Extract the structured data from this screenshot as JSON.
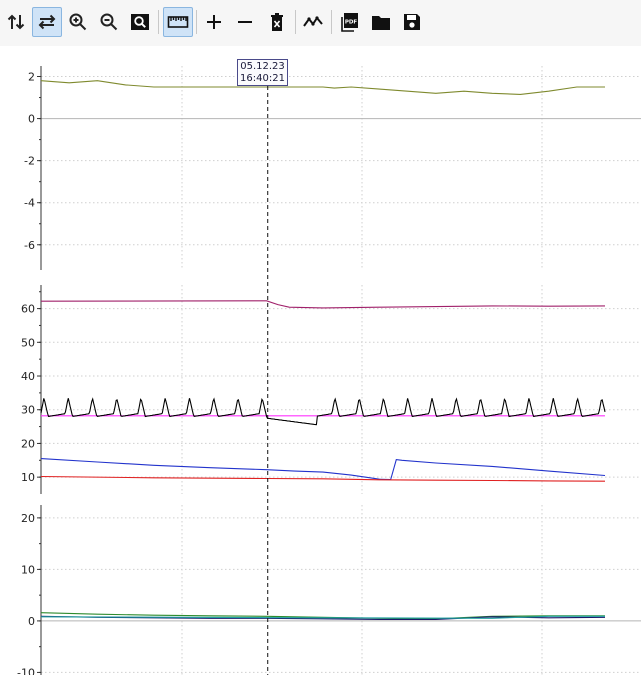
{
  "toolbar": {
    "buttons": [
      {
        "name": "vertical-arrows-icon",
        "active": false
      },
      {
        "name": "horizontal-arrows-icon",
        "active": true
      },
      {
        "name": "zoom-in-icon",
        "active": false
      },
      {
        "name": "zoom-out-icon",
        "active": false
      },
      {
        "name": "zoom-fit-icon",
        "active": false
      },
      {
        "name": "ruler-icon",
        "active": true
      },
      {
        "name": "plus-icon",
        "active": false
      },
      {
        "name": "minus-icon",
        "active": false
      },
      {
        "name": "delete-icon",
        "active": false
      },
      {
        "name": "line-graph-icon",
        "active": false
      },
      {
        "name": "pdf-icon",
        "active": false
      },
      {
        "name": "folder-icon",
        "active": false
      },
      {
        "name": "save-icon",
        "active": false
      }
    ],
    "pdf_icon_text": "PDF"
  },
  "cursor": {
    "date": "05.12.23",
    "time": "16:40:21"
  },
  "chart_data": [
    {
      "type": "line",
      "ylim": [
        -7.2,
        2.5
      ],
      "yticks": [
        "2",
        "0",
        "-2",
        "-4",
        "-6"
      ],
      "ytick_values": [
        2,
        0,
        -2,
        -4,
        -6
      ],
      "grid": true,
      "x_range": [
        0,
        100
      ],
      "series": [
        {
          "color": "#7f8a2e",
          "x": [
            0,
            5,
            10,
            15,
            20,
            30,
            40,
            50,
            52,
            55,
            60,
            65,
            70,
            75,
            80,
            85,
            90,
            95,
            100
          ],
          "y": [
            1.8,
            1.7,
            1.8,
            1.6,
            1.5,
            1.5,
            1.5,
            1.5,
            1.45,
            1.5,
            1.4,
            1.3,
            1.2,
            1.3,
            1.2,
            1.15,
            1.3,
            1.5,
            1.5
          ]
        }
      ]
    },
    {
      "type": "line",
      "ylim": [
        5,
        67
      ],
      "yticks": [
        "60",
        "50",
        "40",
        "30",
        "20",
        "10"
      ],
      "ytick_values": [
        60,
        50,
        40,
        30,
        20,
        10
      ],
      "grid": true,
      "x_range": [
        0,
        100
      ],
      "series": [
        {
          "color": "#a0206a",
          "x": [
            0,
            40,
            42,
            44,
            50,
            60,
            70,
            80,
            90,
            100
          ],
          "y": [
            62.2,
            62.3,
            61.2,
            60.4,
            60.2,
            60.4,
            60.6,
            60.8,
            60.7,
            60.8
          ]
        },
        {
          "color": "#ff33ff",
          "x": [
            0,
            100
          ],
          "y": [
            28.2,
            28.2
          ]
        },
        {
          "color": "#000000",
          "pattern": "spikes",
          "x": [
            0,
            100
          ],
          "y": [
            29,
            29
          ]
        },
        {
          "color": "#2233cc",
          "x": [
            0,
            10,
            20,
            30,
            40,
            45,
            50,
            55,
            60,
            62,
            63,
            64,
            70,
            80,
            90,
            100
          ],
          "y": [
            15.5,
            14.5,
            13.5,
            12.8,
            12.2,
            11.8,
            11.5,
            10.6,
            9.4,
            9.3,
            15.2,
            15,
            14.2,
            13.2,
            11.8,
            10.5
          ]
        },
        {
          "color": "#e02020",
          "x": [
            0,
            20,
            40,
            50,
            60,
            70,
            80,
            90,
            100
          ],
          "y": [
            10.2,
            9.8,
            9.6,
            9.5,
            9.2,
            9.1,
            9.0,
            8.9,
            8.8
          ]
        }
      ]
    },
    {
      "type": "line",
      "ylim": [
        -10.5,
        22.5
      ],
      "yticks": [
        "20",
        "10",
        "0",
        "-10"
      ],
      "ytick_values": [
        20,
        10,
        0,
        -10
      ],
      "grid": true,
      "x_range": [
        0,
        100
      ],
      "series": [
        {
          "color": "#2e8b2e",
          "x": [
            0,
            10,
            20,
            30,
            40,
            50,
            60,
            70,
            80,
            90,
            100
          ],
          "y": [
            1.6,
            1.3,
            1.1,
            1.0,
            0.9,
            0.7,
            0.5,
            0.4,
            0.9,
            1.0,
            1.0
          ]
        },
        {
          "color": "#1a1a6a",
          "x": [
            0,
            10,
            20,
            30,
            40,
            50,
            60,
            70,
            80,
            90,
            100
          ],
          "y": [
            0.9,
            0.7,
            0.6,
            0.5,
            0.5,
            0.4,
            0.3,
            0.3,
            0.8,
            0.6,
            0.7
          ]
        },
        {
          "color": "#20a0a0",
          "x": [
            0,
            50,
            80,
            90,
            100
          ],
          "y": [
            0.8,
            0.6,
            0.5,
            0.9,
            0.9
          ]
        }
      ]
    }
  ],
  "cursor_x": 40.2
}
